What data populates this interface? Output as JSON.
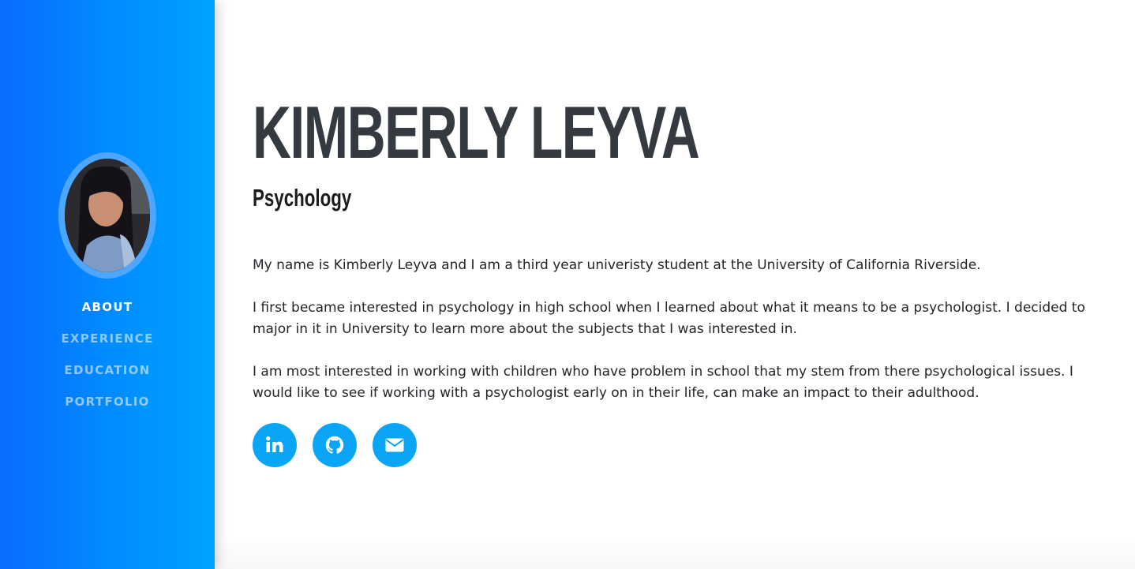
{
  "sidebar": {
    "avatar_alt": "Profile photo",
    "nav": [
      {
        "label": "ABOUT",
        "active": true
      },
      {
        "label": "EXPERIENCE",
        "active": false
      },
      {
        "label": "EDUCATION",
        "active": false
      },
      {
        "label": "PORTFOLIO",
        "active": false
      }
    ],
    "accent_color": "#0a8cff"
  },
  "main": {
    "name": "KIMBERLY LEYVA",
    "subtitle": "Psychology",
    "paragraphs": [
      "My name is Kimberly Leyva and I am a third year univeristy student at the University of California Riverside.",
      "I first became interested in psychology in high school when I learned about what it means to be a psychologist. I decided to major in it in University to learn more about the subjects that I was interested in.",
      "I am most interested in working with children who have problem in school that my stem from there psychological issues. I would like to see if working with a psychologist early on in their life, can make an impact to their adulthood."
    ],
    "social": [
      {
        "icon": "linkedin-icon"
      },
      {
        "icon": "github-icon"
      },
      {
        "icon": "envelope-icon"
      }
    ],
    "social_color": "#0aa5f5"
  }
}
